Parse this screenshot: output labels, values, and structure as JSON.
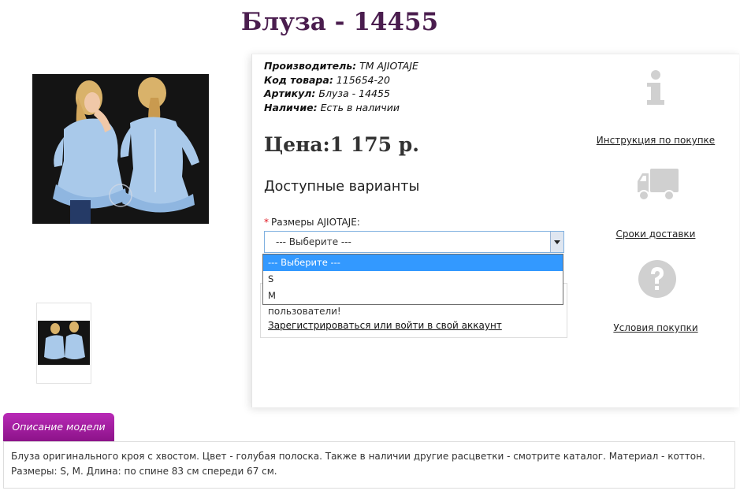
{
  "product": {
    "title": "Блуза - 14455",
    "photo_alt": "блуза голубая",
    "thumb_alt": "блуза голубая"
  },
  "info": {
    "manufacturer_label": "Производитель:",
    "manufacturer_value": "ТМ AJIOTAJE",
    "code_label": "Код товара:",
    "code_value": "115654-20",
    "article_label": "Артикул:",
    "article_value": "Блуза - 14455",
    "stock_label": "Наличие:",
    "stock_value": "Есть в наличии"
  },
  "price": "Цена:1 175 р.",
  "variants_title": "Доступные варианты",
  "size": {
    "required_mark": "*",
    "label": "Размеры AJIOTAJE:",
    "selected": "--- Выберите ---",
    "options": [
      "--- Выберите ---",
      "S",
      "M"
    ]
  },
  "login": {
    "text": "пользователи!",
    "link": "Зарегистрироваться или войти в свой аккаунт"
  },
  "sidebar": {
    "instruction_link": "Инструкция по покупке",
    "delivery_link": "Сроки доставки",
    "terms_link": "Условия покупки",
    "icon_color": "#d0d0d0"
  },
  "tab": {
    "label": "Описание модели",
    "color": "#a11fa0"
  },
  "description": "Блуза оригинального кроя с хвостом. Цвет - голубая полоска. Также в наличии другие расцветки - смотрите каталог. Материал - коттон. Размеры: S, M. Длина: по спине 83 см спереди 67 см."
}
